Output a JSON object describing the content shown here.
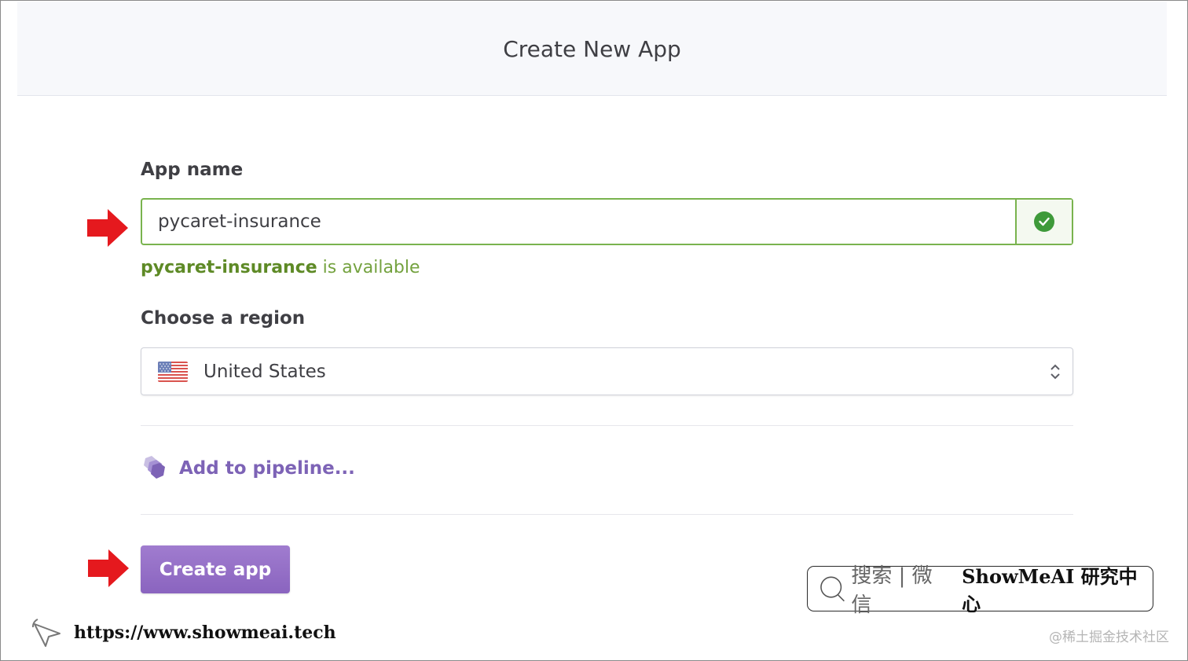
{
  "header": {
    "title": "Create New App"
  },
  "form": {
    "app_name_label": "App name",
    "app_name_value": "pycaret-insurance",
    "availability": {
      "name": "pycaret-insurance",
      "suffix": " is available"
    },
    "region_label": "Choose a region",
    "region_value": "United States",
    "pipeline_label": "Add to pipeline...",
    "create_button": "Create app"
  },
  "watermark": {
    "search_text": "搜索 | 微信",
    "brand": "ShowMeAI 研究中心",
    "url": "https://www.showmeai.tech",
    "juejin": "@稀土掘金技术社区"
  },
  "colors": {
    "success": "#79b34e",
    "accent": "#8a64bf",
    "arrow": "#e5191e"
  },
  "icons": [
    "check-icon",
    "us-flag-icon",
    "updown-chevron-icon",
    "pipeline-icon",
    "arrow-icon",
    "search-icon",
    "cursor-icon"
  ]
}
